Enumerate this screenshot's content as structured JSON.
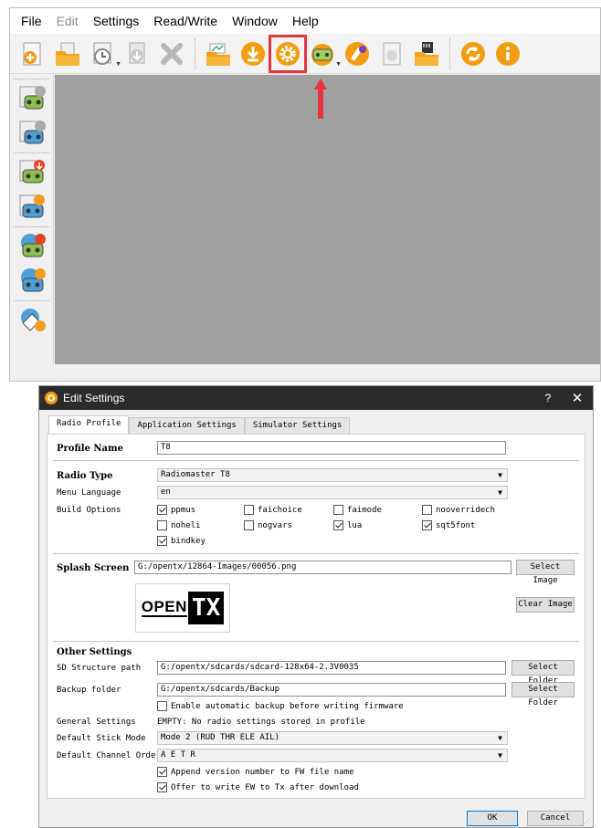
{
  "menu": [
    "File",
    "Edit",
    "Settings",
    "Read/Write",
    "Window",
    "Help"
  ],
  "toolbar_icons": [
    "new-file-icon",
    "open-folder-icon",
    "recent-files-icon",
    "save-icon",
    "close-file-icon",
    "upload-folder-icon",
    "download-icon",
    "settings-gear-icon",
    "radio-settings-icon",
    "compare-icon",
    "print-icon",
    "sd-card-icon",
    "refresh-icon",
    "info-icon"
  ],
  "side_icons": [
    "write-models-icon",
    "read-models-icon",
    "write-radio-icon",
    "read-radio-icon",
    "write-firmware-icon",
    "read-firmware-icon",
    "backup-radio-icon"
  ],
  "colors": {
    "highlight": "#e5343d",
    "mdi_bg": "#a0a0a0",
    "titlebar": "#2b2b2b"
  },
  "dialog": {
    "title": "Edit Settings",
    "help": "?",
    "close": "✕",
    "tabs": [
      "Radio Profile",
      "Application Settings",
      "Simulator Settings"
    ],
    "profile_name_label": "Profile Name",
    "profile_name": "T8",
    "radio_type_label": "Radio Type",
    "radio_type": "Radiomaster T8",
    "menu_language_label": "Menu Language",
    "menu_language": "en",
    "build_options_label": "Build Options",
    "build_options": [
      {
        "label": "ppmus",
        "checked": true
      },
      {
        "label": "faichoice",
        "checked": false
      },
      {
        "label": "faimode",
        "checked": false
      },
      {
        "label": "nooverridech",
        "checked": false
      },
      {
        "label": "noheli",
        "checked": false
      },
      {
        "label": "nogvars",
        "checked": false
      },
      {
        "label": "lua",
        "checked": true
      },
      {
        "label": "sqt5font",
        "checked": true
      },
      {
        "label": "bindkey",
        "checked": true
      }
    ],
    "splash_label": "Splash Screen",
    "splash_path": "G:/opentx/12864-Images/00056.png",
    "select_image": "Select Image",
    "clear_image": "Clear Image",
    "logo_open": "OPEN",
    "logo_tx": "TX",
    "other_settings_label": "Other Settings",
    "sd_path_label": "SD Structure path",
    "sd_path": "G:/opentx/sdcards/sdcard-128x64-2.3V0035",
    "select_folder": "Select Folder",
    "backup_label": "Backup folder",
    "backup_path": "G:/opentx/sdcards/Backup",
    "auto_backup": "Enable automatic backup before writing firmware",
    "general_settings_label": "General Settings",
    "general_settings_value": "EMPTY: No radio settings stored in profile",
    "stick_mode_label": "Default Stick Mode",
    "stick_mode": "Mode 2 (RUD THR ELE AIL)",
    "channel_order_label": "Default Channel Order",
    "channel_order": "A E T R",
    "append_version": "Append version number to FW file name",
    "offer_write": "Offer to write FW to Tx after download",
    "ok": "OK",
    "cancel": "Cancel"
  }
}
